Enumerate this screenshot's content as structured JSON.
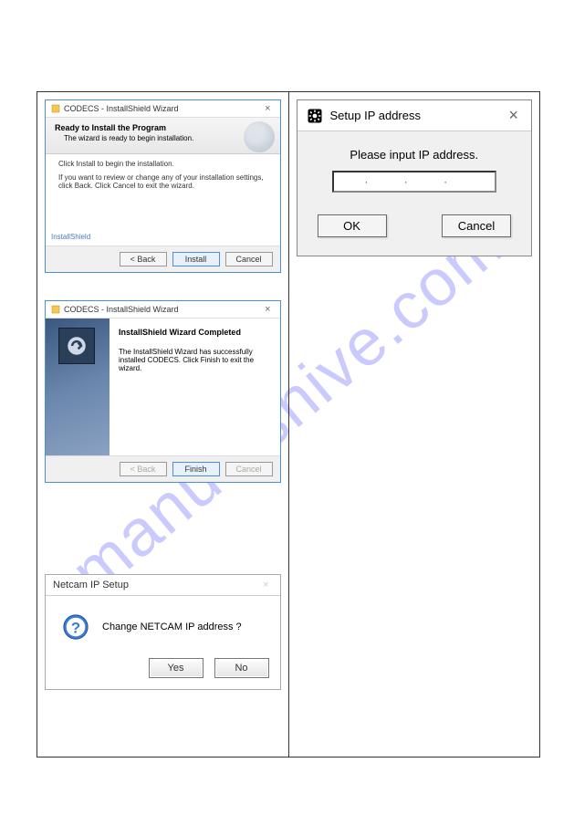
{
  "watermark": "manualshive.com",
  "wizard_ready": {
    "window_title": "CODECS - InstallShield Wizard",
    "header_title": "Ready to Install the Program",
    "header_sub": "The wizard is ready to begin installation.",
    "body_line1": "Click Install to begin the installation.",
    "body_line2": "If you want to review or change any of your installation settings, click Back. Click Cancel to exit the wizard.",
    "brand": "InstallShield",
    "back_label": "< Back",
    "install_label": "Install",
    "cancel_label": "Cancel"
  },
  "wizard_complete": {
    "window_title": "CODECS - InstallShield Wizard",
    "title": "InstallShield Wizard Completed",
    "body": "The InstallShield Wizard has successfully installed CODECS. Click Finish to exit the wizard.",
    "back_label": "< Back",
    "finish_label": "Finish",
    "cancel_label": "Cancel"
  },
  "netcam_prompt": {
    "window_title": "Netcam IP Setup",
    "question": "Change NETCAM IP address ?",
    "yes_label": "Yes",
    "no_label": "No"
  },
  "ip_dialog": {
    "window_title": "Setup IP address",
    "message": "Please input  IP address.",
    "value_display": "·   ·   ·",
    "ok_label": "OK",
    "cancel_label": "Cancel"
  }
}
